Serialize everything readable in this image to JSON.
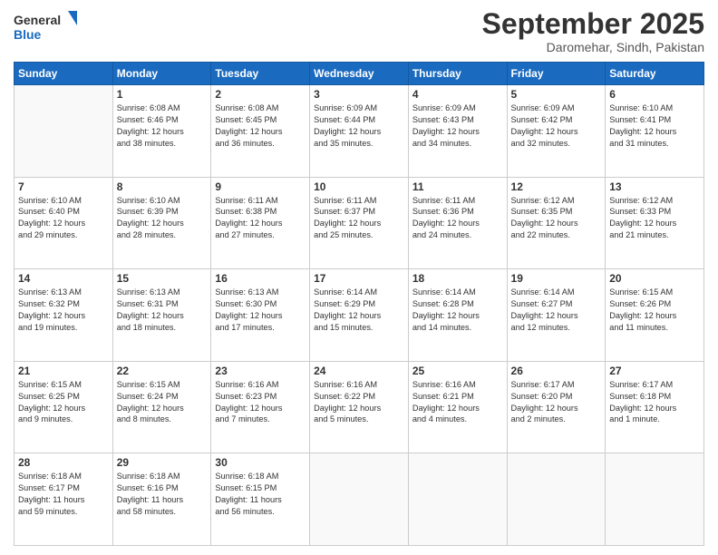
{
  "logo": {
    "general": "General",
    "blue": "Blue"
  },
  "header": {
    "month": "September 2025",
    "location": "Daromehar, Sindh, Pakistan"
  },
  "weekdays": [
    "Sunday",
    "Monday",
    "Tuesday",
    "Wednesday",
    "Thursday",
    "Friday",
    "Saturday"
  ],
  "weeks": [
    [
      {
        "day": "",
        "info": ""
      },
      {
        "day": "1",
        "info": "Sunrise: 6:08 AM\nSunset: 6:46 PM\nDaylight: 12 hours\nand 38 minutes."
      },
      {
        "day": "2",
        "info": "Sunrise: 6:08 AM\nSunset: 6:45 PM\nDaylight: 12 hours\nand 36 minutes."
      },
      {
        "day": "3",
        "info": "Sunrise: 6:09 AM\nSunset: 6:44 PM\nDaylight: 12 hours\nand 35 minutes."
      },
      {
        "day": "4",
        "info": "Sunrise: 6:09 AM\nSunset: 6:43 PM\nDaylight: 12 hours\nand 34 minutes."
      },
      {
        "day": "5",
        "info": "Sunrise: 6:09 AM\nSunset: 6:42 PM\nDaylight: 12 hours\nand 32 minutes."
      },
      {
        "day": "6",
        "info": "Sunrise: 6:10 AM\nSunset: 6:41 PM\nDaylight: 12 hours\nand 31 minutes."
      }
    ],
    [
      {
        "day": "7",
        "info": "Sunrise: 6:10 AM\nSunset: 6:40 PM\nDaylight: 12 hours\nand 29 minutes."
      },
      {
        "day": "8",
        "info": "Sunrise: 6:10 AM\nSunset: 6:39 PM\nDaylight: 12 hours\nand 28 minutes."
      },
      {
        "day": "9",
        "info": "Sunrise: 6:11 AM\nSunset: 6:38 PM\nDaylight: 12 hours\nand 27 minutes."
      },
      {
        "day": "10",
        "info": "Sunrise: 6:11 AM\nSunset: 6:37 PM\nDaylight: 12 hours\nand 25 minutes."
      },
      {
        "day": "11",
        "info": "Sunrise: 6:11 AM\nSunset: 6:36 PM\nDaylight: 12 hours\nand 24 minutes."
      },
      {
        "day": "12",
        "info": "Sunrise: 6:12 AM\nSunset: 6:35 PM\nDaylight: 12 hours\nand 22 minutes."
      },
      {
        "day": "13",
        "info": "Sunrise: 6:12 AM\nSunset: 6:33 PM\nDaylight: 12 hours\nand 21 minutes."
      }
    ],
    [
      {
        "day": "14",
        "info": "Sunrise: 6:13 AM\nSunset: 6:32 PM\nDaylight: 12 hours\nand 19 minutes."
      },
      {
        "day": "15",
        "info": "Sunrise: 6:13 AM\nSunset: 6:31 PM\nDaylight: 12 hours\nand 18 minutes."
      },
      {
        "day": "16",
        "info": "Sunrise: 6:13 AM\nSunset: 6:30 PM\nDaylight: 12 hours\nand 17 minutes."
      },
      {
        "day": "17",
        "info": "Sunrise: 6:14 AM\nSunset: 6:29 PM\nDaylight: 12 hours\nand 15 minutes."
      },
      {
        "day": "18",
        "info": "Sunrise: 6:14 AM\nSunset: 6:28 PM\nDaylight: 12 hours\nand 14 minutes."
      },
      {
        "day": "19",
        "info": "Sunrise: 6:14 AM\nSunset: 6:27 PM\nDaylight: 12 hours\nand 12 minutes."
      },
      {
        "day": "20",
        "info": "Sunrise: 6:15 AM\nSunset: 6:26 PM\nDaylight: 12 hours\nand 11 minutes."
      }
    ],
    [
      {
        "day": "21",
        "info": "Sunrise: 6:15 AM\nSunset: 6:25 PM\nDaylight: 12 hours\nand 9 minutes."
      },
      {
        "day": "22",
        "info": "Sunrise: 6:15 AM\nSunset: 6:24 PM\nDaylight: 12 hours\nand 8 minutes."
      },
      {
        "day": "23",
        "info": "Sunrise: 6:16 AM\nSunset: 6:23 PM\nDaylight: 12 hours\nand 7 minutes."
      },
      {
        "day": "24",
        "info": "Sunrise: 6:16 AM\nSunset: 6:22 PM\nDaylight: 12 hours\nand 5 minutes."
      },
      {
        "day": "25",
        "info": "Sunrise: 6:16 AM\nSunset: 6:21 PM\nDaylight: 12 hours\nand 4 minutes."
      },
      {
        "day": "26",
        "info": "Sunrise: 6:17 AM\nSunset: 6:20 PM\nDaylight: 12 hours\nand 2 minutes."
      },
      {
        "day": "27",
        "info": "Sunrise: 6:17 AM\nSunset: 6:18 PM\nDaylight: 12 hours\nand 1 minute."
      }
    ],
    [
      {
        "day": "28",
        "info": "Sunrise: 6:18 AM\nSunset: 6:17 PM\nDaylight: 11 hours\nand 59 minutes."
      },
      {
        "day": "29",
        "info": "Sunrise: 6:18 AM\nSunset: 6:16 PM\nDaylight: 11 hours\nand 58 minutes."
      },
      {
        "day": "30",
        "info": "Sunrise: 6:18 AM\nSunset: 6:15 PM\nDaylight: 11 hours\nand 56 minutes."
      },
      {
        "day": "",
        "info": ""
      },
      {
        "day": "",
        "info": ""
      },
      {
        "day": "",
        "info": ""
      },
      {
        "day": "",
        "info": ""
      }
    ]
  ]
}
